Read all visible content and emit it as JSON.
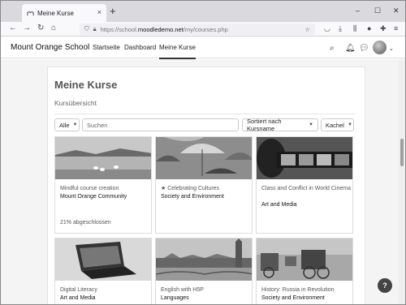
{
  "browser": {
    "tab_title": "Meine Kurse",
    "tab_close": "×",
    "new_tab": "+",
    "window_controls": [
      "–",
      "☐",
      "✕"
    ],
    "url_prefix": "https://school.",
    "url_domain": "moodledemo.net",
    "url_path": "/my/courses.php"
  },
  "site": {
    "name": "Mount Orange School",
    "nav": [
      "Startseite",
      "Dashboard",
      "Meine Kurse"
    ],
    "active_nav": "Meine Kurse"
  },
  "page": {
    "title": "Meine Kurse",
    "subtitle": "Kursübersicht"
  },
  "filters": {
    "grouping": "Alle",
    "search_placeholder": "Suchen",
    "sort": "Sortiert nach Kursname",
    "view": "Kachel"
  },
  "courses": [
    {
      "category": "Mindful course creation",
      "name": "Mount Orange Community",
      "progress": "21% abgeschlossen",
      "starred": false
    },
    {
      "category": "Celebrating Cultures",
      "name": "Society and Environment",
      "progress": "",
      "starred": true
    },
    {
      "category": "Class and Conflict in World Cinema",
      "name": "Art and Media",
      "progress": "",
      "starred": false
    },
    {
      "category": "Digital Literacy",
      "name": "Art and Media",
      "progress": "",
      "starred": false
    },
    {
      "category": "English with H5P",
      "name": "Languages",
      "progress": "",
      "starred": false
    },
    {
      "category": "History: Russia in Revolution",
      "name": "Society and Environment",
      "progress": "",
      "starred": false
    }
  ],
  "help_label": "?"
}
